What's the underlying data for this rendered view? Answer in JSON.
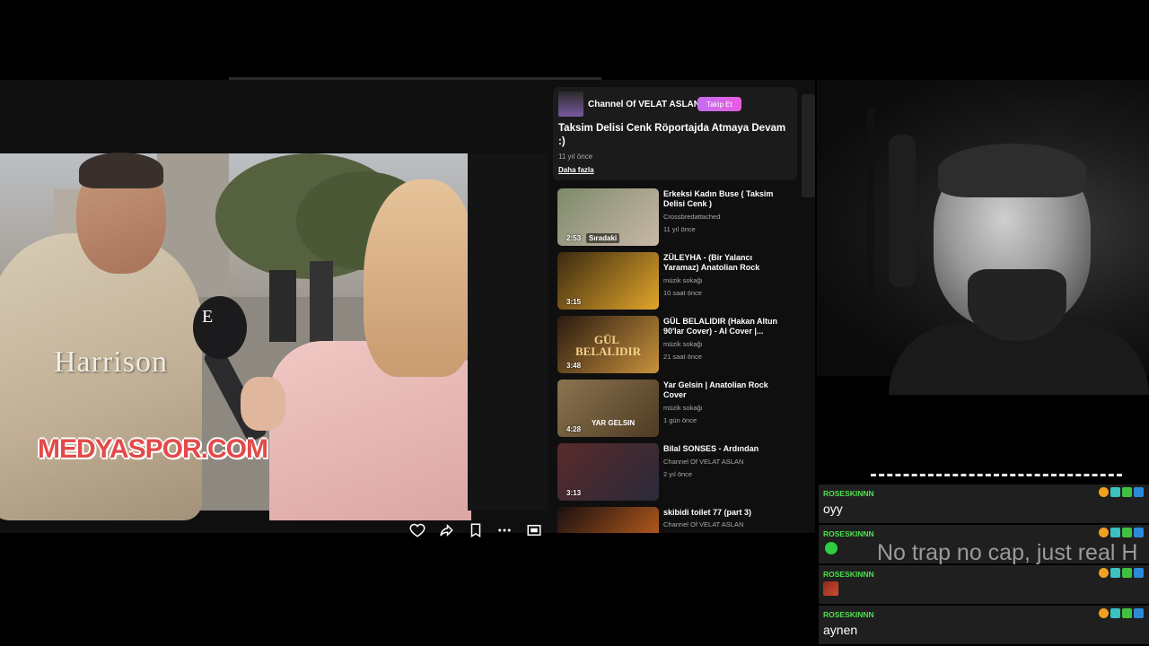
{
  "channel": {
    "name": "Channel Of VELAT ASLAN",
    "follow_label": "Takip Et"
  },
  "video": {
    "title": "Taksim Delisi Cenk Röportajda Atmaya Devam :)",
    "age": "11 yıl önce",
    "more_label": "Daha fazla",
    "jacket_text": "Harrison",
    "mic_logo": "E",
    "watermark": "MEDYASPOR.COM"
  },
  "controls": [
    {
      "name": "like-icon"
    },
    {
      "name": "share-icon"
    },
    {
      "name": "save-icon"
    },
    {
      "name": "more-icon"
    },
    {
      "name": "miniplayer-icon"
    }
  ],
  "recommendations": [
    {
      "title": "Erkeksi Kadın Buse ( Taksim Delisi Cenk )",
      "channel": "Crossbredattached",
      "meta": "11 yıl önce",
      "duration": "2:53",
      "next_label": "Sıradaki",
      "thumb_colors": [
        "#7d8a6a",
        "#c9b8a8"
      ]
    },
    {
      "title": "ZÜLEYHA - (Bir Yalancı Yaramaz) Anatolian Rock",
      "channel": "müzik sokağı",
      "meta": "10 saat önce",
      "duration": "3:15",
      "thumb_colors": [
        "#3a2a10",
        "#e2a52a"
      ]
    },
    {
      "title": "GÜL BELALIDIR (Hakan Altun 90'lar Cover) - AI Cover |...",
      "channel": "müzik sokağı",
      "meta": "21 saat önce",
      "duration": "3:48",
      "thumb_text": "GÜL BELALIDIR",
      "thumb_colors": [
        "#2a1a10",
        "#c8923c"
      ]
    },
    {
      "title": "Yar Gelsin | Anatolian Rock Cover",
      "channel": "müzik sokağı",
      "meta": "1 gün önce",
      "duration": "4:28",
      "thumb_text": "YAR GELSIN",
      "thumb_colors": [
        "#8a7450",
        "#4e3b22"
      ]
    },
    {
      "title": "Bilal SONSES - Ardından",
      "channel": "Channel Of VELAT ASLAN",
      "meta": "2 yıl önce",
      "duration": "3:13",
      "thumb_colors": [
        "#5a2a2a",
        "#2a2a3a"
      ]
    },
    {
      "title": "skibidi toilet 77 (part 3)",
      "channel": "Channel Of VELAT ASLAN",
      "meta": "",
      "duration": "",
      "thumb_colors": [
        "#1a1010",
        "#d2691e"
      ]
    }
  ],
  "chat": {
    "messages": [
      {
        "user": "ROSESKINNN",
        "text": "oyy",
        "emote": ""
      },
      {
        "user": "ROSESKINNN",
        "text": "",
        "emote": "green"
      },
      {
        "user": "ROSESKINNN",
        "text": "",
        "emote": "red"
      },
      {
        "user": "ROSESKINNN",
        "text": "aynen",
        "emote": ""
      }
    ],
    "badge_colors": [
      "#f0a020",
      "#3cc0c0",
      "#40c040",
      "#2a8ad8"
    ],
    "overlay_text": "No trap no cap, just real H"
  },
  "colors": {
    "accent_follow": "#d066ea",
    "chat_username": "#4ee04e"
  }
}
